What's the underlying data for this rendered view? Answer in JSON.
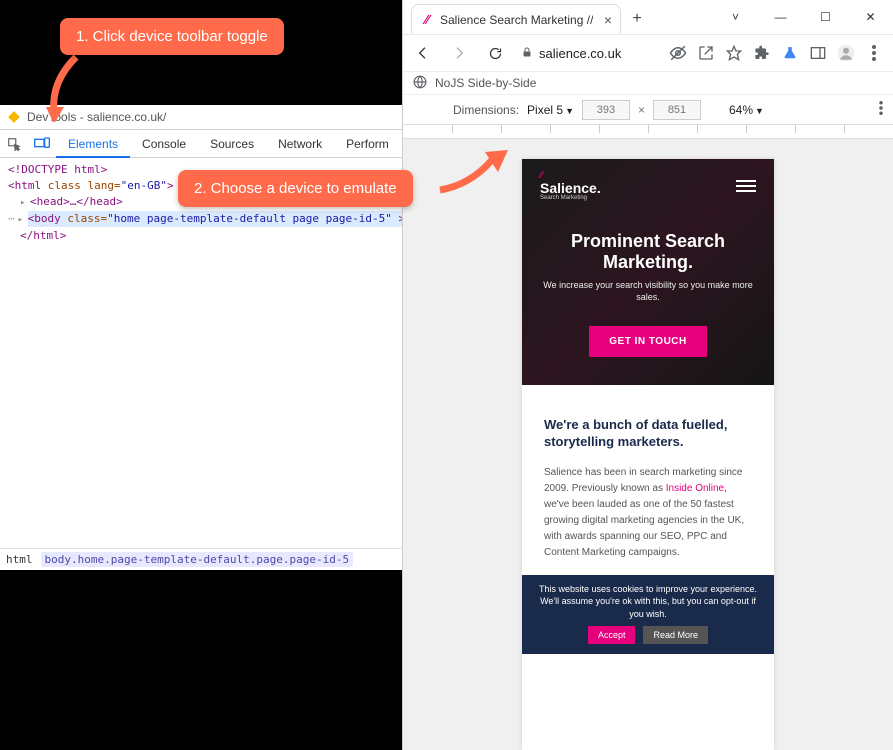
{
  "callouts": {
    "c1": "1. Click device toolbar toggle",
    "c2": "2. Choose a device to emulate"
  },
  "devtools": {
    "window_title": "DevTools - salience.co.uk/",
    "tabs": {
      "elements": "Elements",
      "console": "Console",
      "sources": "Sources",
      "network": "Network",
      "performance": "Perform"
    },
    "dom": {
      "doctype": "<!DOCTYPE html>",
      "html_open_a": "<",
      "html_tag": "html",
      "html_class_attr": "class",
      "html_class_val": "en-GB",
      "html_lang_attr": "lang",
      "html_close": ">",
      "head_collapsed": "<head>…</head>",
      "body_open_a": "<",
      "body_tag": "body",
      "body_class_attr": "class",
      "body_class_val": "home page-template-default page page-id-5",
      "body_end": " >",
      "html_end": "</html>"
    },
    "breadcrumb": {
      "root": "html",
      "path": "body.home.page-template-default.page.page-id-5"
    }
  },
  "browser": {
    "tab_title": "Salience Search Marketing //",
    "url": "salience.co.uk",
    "nojs_label": "NoJS Side-by-Side",
    "emubar": {
      "dimensions_label": "Dimensions:",
      "device": "Pixel 5",
      "width": "393",
      "height": "851",
      "zoom": "64%"
    }
  },
  "page": {
    "logo_main": "Salience.",
    "logo_sub": "Search Marketing",
    "hero_title": "Prominent Search Marketing.",
    "hero_sub": "We increase your search visibility so you make more sales.",
    "cta": "GET IN TOUCH",
    "body_heading": "We're a bunch of data fuelled, storytelling marketers.",
    "body_p1_a": "Salience has been in search marketing since 2009. Previously known as ",
    "body_link": "Inside Online",
    "body_p1_b": ", we've been lauded as one of the 50 fastest growing digital marketing agencies in the UK, with awards spanning our SEO, PPC and Content Marketing campaigns.",
    "cookie_text": "This website uses cookies to improve your experience. We'll assume you're ok with this, but you can opt-out if you wish.",
    "cookie_accept": "Accept",
    "cookie_read": "Read More"
  }
}
